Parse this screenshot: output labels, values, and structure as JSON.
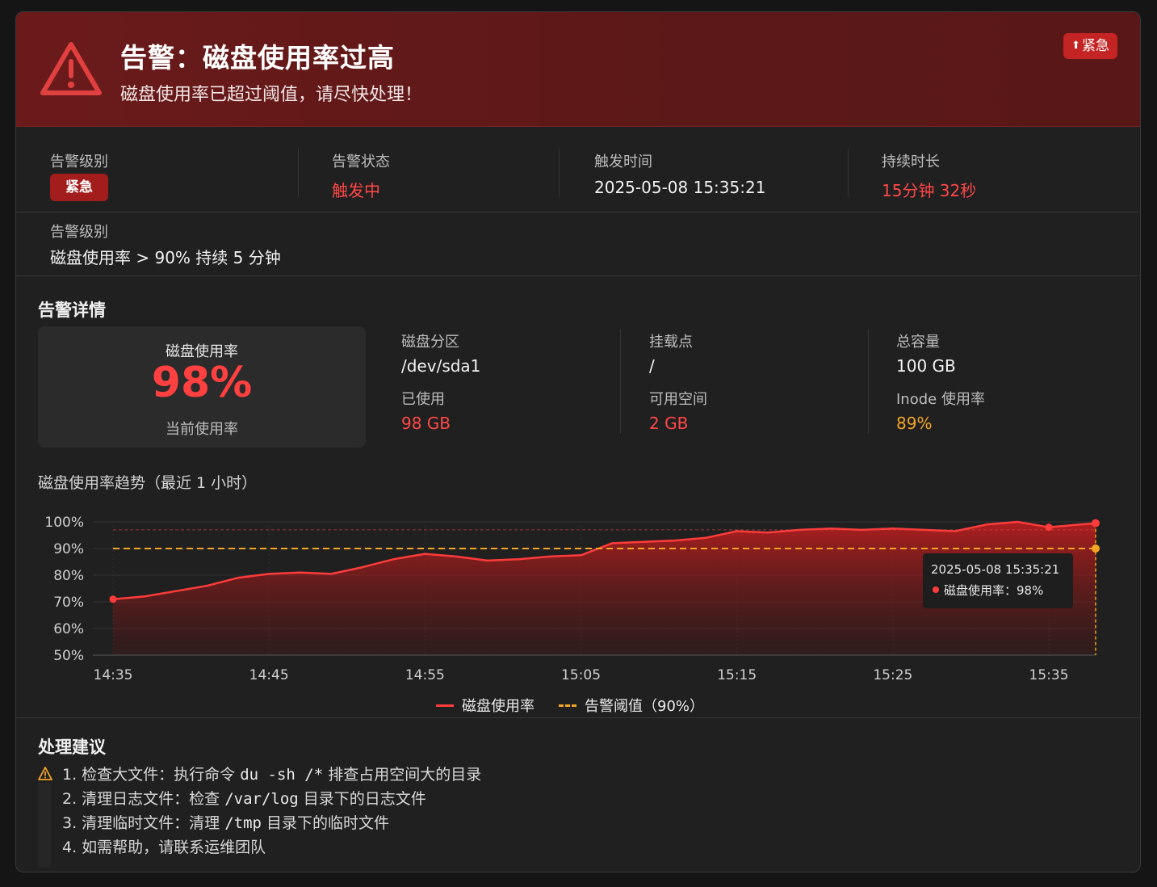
{
  "header": {
    "title": "告警：磁盘使用率过高",
    "subtitle": "磁盘使用率已超过阈值，请尽快处理！",
    "tag_label": "紧急",
    "tag_icon": "arrow-up-icon"
  },
  "summary": {
    "level_label": "告警级别",
    "level_value": "紧急",
    "status_label": "告警状态",
    "status_value": "触发中",
    "time_label": "触发时间",
    "time_value": "2025-05-08 15:35:21",
    "duration_label": "持续时长",
    "duration_value": "15分钟 32秒"
  },
  "rule": {
    "label": "告警级别",
    "value": "磁盘使用率 > 90% 持续 5 分钟"
  },
  "details": {
    "title": "告警详情",
    "usage_title": "磁盘使用率",
    "usage_value": "98%",
    "usage_sub": "当前使用率",
    "partition_label": "磁盘分区",
    "partition_value": "/dev/sda1",
    "mount_label": "挂载点",
    "mount_value": "/",
    "total_label": "总容量",
    "total_value": "100 GB",
    "used_label": "已使用",
    "used_value": "98 GB",
    "free_label": "可用空间",
    "free_value": "2 GB",
    "inode_label": "Inode 使用率",
    "inode_value": "89%"
  },
  "chart_data": {
    "type": "area",
    "title": "磁盘使用率趋势（最近 1 小时）",
    "ylim": [
      50,
      100
    ],
    "y_ticks": [
      "100%",
      "90%",
      "80%",
      "70%",
      "60%",
      "50%"
    ],
    "x_ticks": [
      "14:35",
      "14:45",
      "14:55",
      "15:05",
      "15:15",
      "15:25",
      "15:35"
    ],
    "x_minutes": [
      0,
      2,
      4,
      6,
      8,
      10,
      12,
      14,
      16,
      18,
      20,
      22,
      24,
      26,
      28,
      30,
      32,
      34,
      36,
      38,
      40,
      42,
      44,
      46,
      48,
      50,
      52,
      54,
      56,
      58,
      60,
      62,
      63
    ],
    "series": [
      {
        "name": "磁盘使用率",
        "color": "#ff3b3b",
        "values": [
          71,
          72,
          74,
          76,
          79,
          80.5,
          81,
          80.5,
          83,
          86,
          88,
          87,
          85.5,
          86,
          87,
          87.5,
          92,
          92.5,
          93,
          94,
          96.5,
          96,
          97,
          97.5,
          97,
          97.5,
          97,
          96.5,
          99,
          100,
          98,
          99,
          99.5
        ]
      },
      {
        "name": "告警阈值（90%）",
        "color": "#f5a524",
        "values": [
          90,
          90,
          90,
          90,
          90,
          90,
          90,
          90,
          90,
          90,
          90,
          90,
          90,
          90,
          90,
          90,
          90,
          90,
          90,
          90,
          90,
          90,
          90,
          90,
          90,
          90,
          90,
          90,
          90,
          90,
          90,
          90,
          90
        ]
      }
    ],
    "tooltip": {
      "time": "2025-05-08 15:35:21",
      "text": "磁盘使用率：98%"
    },
    "legend": [
      "磁盘使用率",
      "告警阈值（90%）"
    ]
  },
  "suggestions": {
    "title": "处理建议",
    "icon": "warning-icon",
    "step1_a": "1. 检查大文件：执行命令 ",
    "step1_code": "du -sh /*",
    "step1_b": " 排查占用空间大的目录",
    "step2_a": "2. 清理日志文件：检查 ",
    "step2_code": "/var/log",
    "step2_b": " 目录下的日志文件",
    "step3_a": "3. 清理临时文件：清理 ",
    "step3_code": "/tmp",
    "step3_b": " 目录下的临时文件",
    "step4": "4. 如需帮助，请联系运维团队"
  }
}
